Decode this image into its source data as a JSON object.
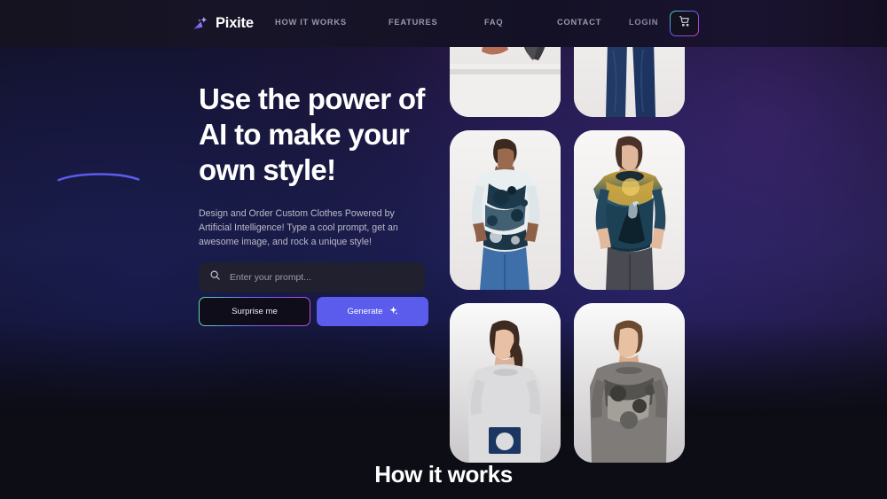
{
  "brand": {
    "name": "Pixite",
    "logo_icon": "sparkle-wand-icon"
  },
  "nav": {
    "items": [
      {
        "label": "HOW IT WORKS"
      },
      {
        "label": "FEATURES"
      },
      {
        "label": "FAQ"
      },
      {
        "label": "CONTACT"
      },
      {
        "label": "LOGIN"
      }
    ],
    "cart_icon": "shopping-cart-icon"
  },
  "hero": {
    "title_line1": "Use the power of",
    "title_line2": "AI to make your",
    "title_line3": "own style!",
    "subtitle": "Design and Order Custom Clothes Powered by Artificial Intelligence! Type a cool prompt, get an awesome image, and rock a unique style!",
    "prompt": {
      "value": "",
      "placeholder": "Enter your prompt...",
      "search_icon": "search-icon"
    },
    "surprise_label": "Surprise me",
    "generate_label": "Generate",
    "generate_icon": "sparkle-icon"
  },
  "gallery": {
    "rows": [
      [
        {
          "alt": "Person in dark abstract-print shirt seated"
        },
        {
          "alt": "Person in purple tie-dye shirt and blue jeans"
        }
      ],
      [
        {
          "alt": "Man wearing navy and white splatter print t-shirt"
        },
        {
          "alt": "Woman wearing golden heron landscape print t-shirt"
        }
      ],
      [
        {
          "alt": "Woman wearing light grey graphic sweatshirt"
        },
        {
          "alt": "Man wearing grey abstract print shirt"
        }
      ]
    ]
  },
  "sections": {
    "how_it_works_title": "How it works"
  },
  "colors": {
    "accent": "#5b5bec",
    "gradient_start": "#5fe0a8",
    "gradient_mid": "#6b74ee",
    "gradient_end": "#c050c6",
    "background": "#0c0c14",
    "underline": "#5b5bec"
  }
}
